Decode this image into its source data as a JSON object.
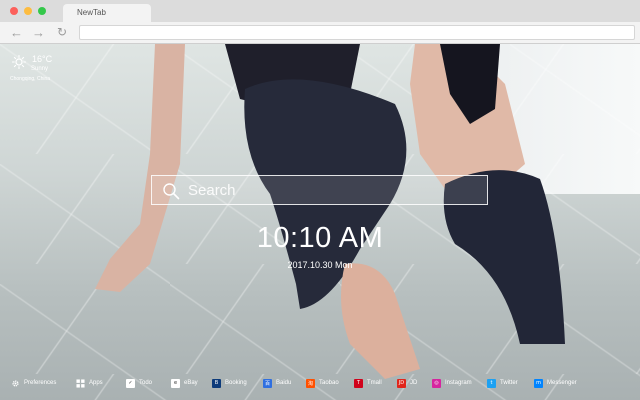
{
  "browser": {
    "tab_title": "NewTab",
    "back_glyph": "←",
    "forward_glyph": "→",
    "reload_glyph": "↻"
  },
  "weather": {
    "temperature": "16°C",
    "condition": "Sunny",
    "location": "Chongqing,  China",
    "icon": "sun-icon"
  },
  "search": {
    "placeholder": "Search",
    "value": ""
  },
  "clock": {
    "time": "10:10 AM",
    "date": "2017.10.30 Mon"
  },
  "bottom_bar": {
    "left": [
      {
        "label": "Preferences",
        "icon": "gear-icon"
      },
      {
        "label": "Apps",
        "icon": "grid-icon"
      }
    ],
    "links": [
      {
        "label": "Todo",
        "icon": "check-icon",
        "color": "#ffffff",
        "glyph": "✓"
      },
      {
        "label": "eBay",
        "icon": "ebay-icon",
        "color": "#ffffff",
        "glyph": "e"
      },
      {
        "label": "Booking",
        "icon": "booking-icon",
        "color": "#0c3a7a",
        "glyph": "B"
      },
      {
        "label": "Baidu",
        "icon": "baidu-icon",
        "color": "#2f6fe0",
        "glyph": "百"
      },
      {
        "label": "Taobao",
        "icon": "taobao-icon",
        "color": "#ff5000",
        "glyph": "淘"
      },
      {
        "label": "Tmall",
        "icon": "tmall-icon",
        "color": "#d0021b",
        "glyph": "T"
      },
      {
        "label": "JD",
        "icon": "jd-icon",
        "color": "#e1251b",
        "glyph": "JD"
      },
      {
        "label": "Instagram",
        "icon": "instagram-icon",
        "color": "#d6249f",
        "glyph": "◎"
      },
      {
        "label": "Twitter",
        "icon": "twitter-icon",
        "color": "#1da1f2",
        "glyph": "t"
      },
      {
        "label": "Messenger",
        "icon": "messenger-icon",
        "color": "#0084ff",
        "glyph": "m"
      }
    ]
  }
}
